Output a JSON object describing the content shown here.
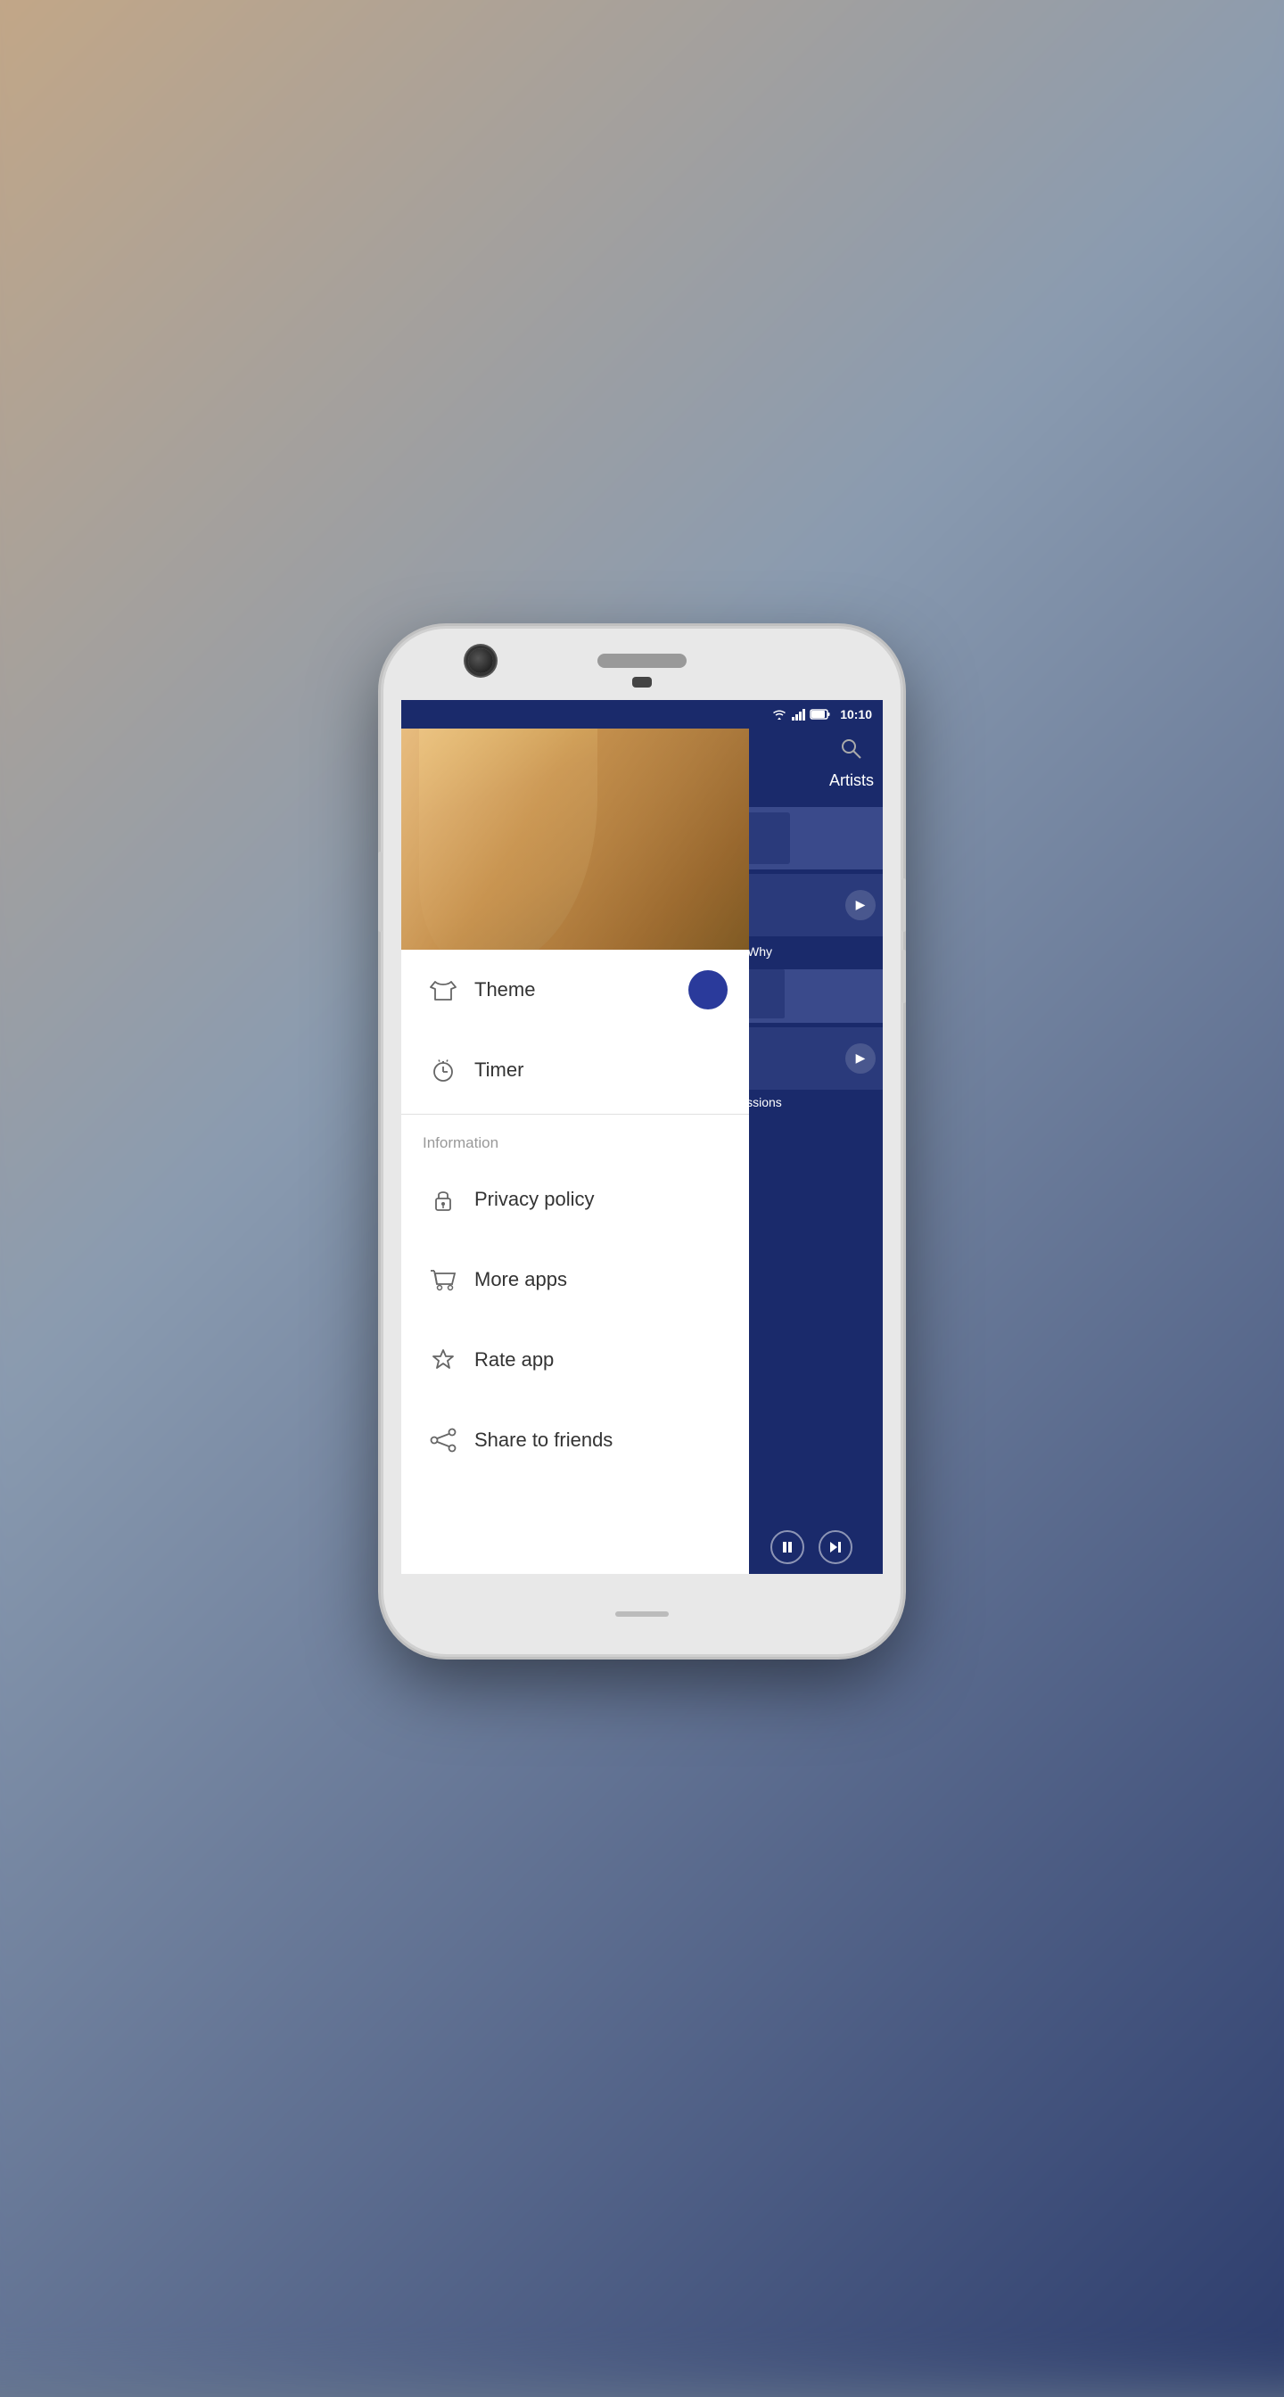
{
  "status_bar": {
    "time": "10:10",
    "wifi_icon": "wifi",
    "signal_icon": "signal",
    "battery_icon": "battery"
  },
  "app_bg": {
    "search_icon": "search",
    "artists_label": "Artists",
    "why_label": "Why",
    "sessions_label": "issions"
  },
  "player": {
    "pause_icon": "pause",
    "skip_icon": "skip-forward"
  },
  "drawer": {
    "music_note": "♪",
    "theme_section": {
      "theme_label": "Theme",
      "theme_icon": "tshirt",
      "toggle_active": true
    },
    "timer": {
      "label": "Timer",
      "icon": "timer"
    },
    "information_section": {
      "header": "Information",
      "privacy_policy": {
        "label": "Privacy policy",
        "icon": "lock"
      },
      "more_apps": {
        "label": "More apps",
        "icon": "cart"
      },
      "rate_app": {
        "label": "Rate app",
        "icon": "star"
      },
      "share_to_friends": {
        "label": "Share to friends",
        "icon": "share"
      }
    }
  }
}
